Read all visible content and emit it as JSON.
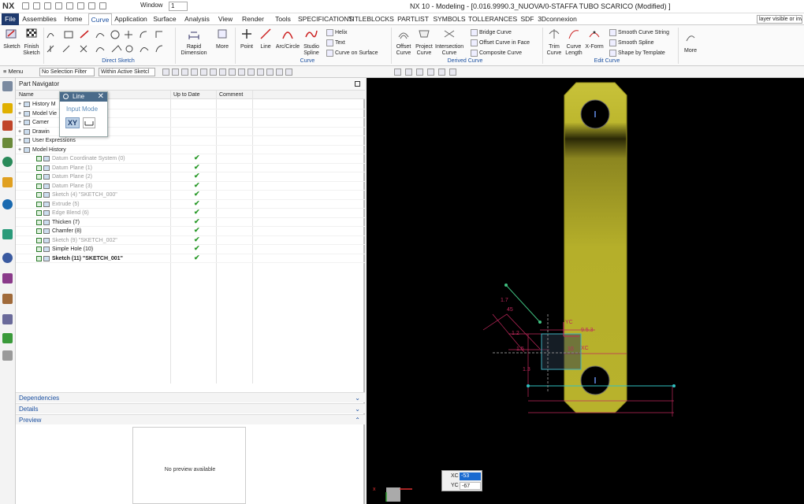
{
  "app": {
    "logo": "NX",
    "window_menu": "Window",
    "window_index": "1",
    "title": "NX 10 - Modeling - [0.016.9990.3_NUOVA/0-STAFFA TUBO SCARICO (Modified) ]"
  },
  "tabs": [
    "File",
    "Assemblies",
    "Home",
    "Curve",
    "Application",
    "Surface",
    "Analysis",
    "View",
    "Render",
    "Tools",
    "SPECIFICATIONS",
    "TITLEBLOCKS",
    "PARTLIST",
    "SYMBOLS",
    "TOLLERANCES",
    "SDF",
    "3Dconnexion"
  ],
  "active_tab": "Curve",
  "search_placeholder": "layer visible or inv",
  "ribbon": {
    "sketch": "Sketch",
    "finish_sketch": "Finish Sketch",
    "rapid_dimension": "Rapid Dimension",
    "more": "More",
    "point": "Point",
    "line": "Line",
    "arc_circle": "Arc/Circle",
    "studio_spline": "Studio Spline",
    "helix": "Helix",
    "text": "Text",
    "curve_on_surface": "Curve on Surface",
    "offset_curve": "Offset Curve",
    "project_curve": "Project Curve",
    "intersection_curve": "Intersection Curve",
    "bridge_curve": "Bridge Curve",
    "offset_curve_in_face": "Offset Curve in Face",
    "composite_curve": "Composite Curve",
    "trim_curve": "Trim Curve",
    "curve_length": "Curve Length",
    "x_form": "X-Form",
    "smooth_curve_string": "Smooth Curve String",
    "smooth_spline": "Smooth Spline",
    "shape_by_template": "Shape by Template",
    "more2": "More",
    "group_direct_sketch": "Direct Sketch",
    "group_curve": "Curve",
    "group_derived_curve": "Derived Curve",
    "group_edit_curve": "Edit Curve"
  },
  "toolbar2": {
    "menu": "Menu",
    "selection_filter": "No Selection Filter",
    "scope": "Within Active Sketcl"
  },
  "navigator": {
    "title": "Part Navigator",
    "col_name": "Name",
    "col_uptodate": "Up to Date",
    "col_comment": "Comment",
    "tree": [
      {
        "label": "History M",
        "indent": 0,
        "style": "normal",
        "check": false
      },
      {
        "label": "Model Vie",
        "indent": 0,
        "style": "normal",
        "check": false
      },
      {
        "label": "Camer",
        "indent": 0,
        "style": "normal",
        "check": false
      },
      {
        "label": "Drawin",
        "indent": 0,
        "style": "normal",
        "check": false
      },
      {
        "label": "User Expressions",
        "indent": 0,
        "style": "normal",
        "check": false
      },
      {
        "label": "Model History",
        "indent": 0,
        "style": "normal",
        "check": false
      },
      {
        "label": "Datum Coordinate System (0)",
        "indent": 1,
        "style": "grey",
        "check": true
      },
      {
        "label": "Datum Plane (1)",
        "indent": 1,
        "style": "grey",
        "check": true
      },
      {
        "label": "Datum Plane (2)",
        "indent": 1,
        "style": "grey",
        "check": true
      },
      {
        "label": "Datum Plane (3)",
        "indent": 1,
        "style": "grey",
        "check": true
      },
      {
        "label": "Sketch (4) \"SKETCH_000\"",
        "indent": 1,
        "style": "grey",
        "check": true
      },
      {
        "label": "Extrude (5)",
        "indent": 1,
        "style": "grey",
        "check": true
      },
      {
        "label": "Edge Blend (6)",
        "indent": 1,
        "style": "grey",
        "check": true
      },
      {
        "label": "Thicken (7)",
        "indent": 1,
        "style": "normal",
        "check": true
      },
      {
        "label": "Chamfer (8)",
        "indent": 1,
        "style": "normal",
        "check": true
      },
      {
        "label": "Sketch (9) \"SKETCH_002\"",
        "indent": 1,
        "style": "grey",
        "check": true
      },
      {
        "label": "Simple Hole (10)",
        "indent": 1,
        "style": "normal",
        "check": true
      },
      {
        "label": "Sketch (11) \"SKETCH_001\"",
        "indent": 1,
        "style": "bold",
        "check": true
      }
    ],
    "check_glyph": "✔"
  },
  "line_popup": {
    "title": "Line",
    "input_mode": "Input Mode",
    "xy": "XY"
  },
  "panels": {
    "dependencies": "Dependencies",
    "details": "Details",
    "preview": "Preview",
    "no_preview": "No preview available"
  },
  "viewport": {
    "dims": [
      "9.5.3",
      "1.2",
      "1.3",
      "1.5",
      "45",
      "1.7",
      "10"
    ],
    "axis_yc": "YC",
    "axis_xc": "XC"
  },
  "coords": {
    "xc_label": "XC",
    "xc_value": "-53",
    "yc_label": "YC",
    "yc_value": "-67"
  },
  "colors": {
    "part": "#b8b22c",
    "sketch": "#d0106a",
    "dimension": "#c0285c",
    "accent": "#1a4fa0",
    "check": "#2a9a2a"
  }
}
